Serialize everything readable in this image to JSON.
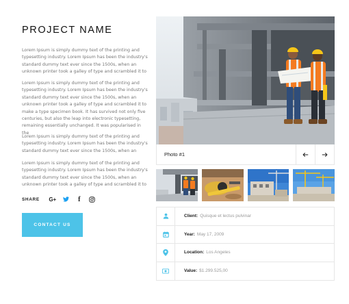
{
  "project": {
    "title": "PROJECT NAME",
    "paragraphs": [
      "Lorem Ipsum is simply dummy text of the printing and typesetting industry. Lorem Ipsum has been the industry's standard dummy text ever since the 1500s, when an unknown printer took a galley of type and scrambled it to",
      "Lorem Ipsum is simply dummy text of the printing and typesetting industry. Lorem Ipsum has been the industry's standard dummy text ever since the 1500s, when an unknown printer took a galley of type and scrambled it to make a type specimen book. It has survived not only five centuries, but also the leap into electronic typesetting, remaining essentially unchanged. It was popularised in the",
      "Lorem Ipsum is simply dummy text of the printing and typesetting industry. Lorem Ipsum has been the industry's standard dummy text ever since the 1500s, when an",
      "Lorem Ipsum is simply dummy text of the printing and typesetting industry. Lorem Ipsum has been the industry's standard dummy text ever since the 1500s, when an unknown printer took a galley of type and scrambled it to"
    ]
  },
  "share": {
    "label": "SHARE",
    "icons": [
      "google-plus-icon",
      "twitter-icon",
      "facebook-icon",
      "instagram-icon"
    ],
    "google_plus_glyph": "G+",
    "facebook_glyph": "f"
  },
  "contact": {
    "label": "CONTACT US"
  },
  "gallery": {
    "caption": "Photo #1",
    "thumbnails": [
      "workers-thumb",
      "tools-thumb",
      "construction-site-thumb",
      "crane-site-thumb"
    ]
  },
  "details": [
    {
      "icon": "person-icon",
      "label": "Client:",
      "value": "Quisque et lectus pulvinar"
    },
    {
      "icon": "calendar-icon",
      "label": "Year:",
      "value": "May 17, 2009"
    },
    {
      "icon": "location-pin-icon",
      "label": "Location:",
      "value": "Los Angeles"
    },
    {
      "icon": "money-icon",
      "label": "Value:",
      "value": "$1.299.525,00"
    }
  ],
  "colors": {
    "accent": "#4dc3e8",
    "vest": "#f47b20",
    "helmet": "#f5c518"
  }
}
